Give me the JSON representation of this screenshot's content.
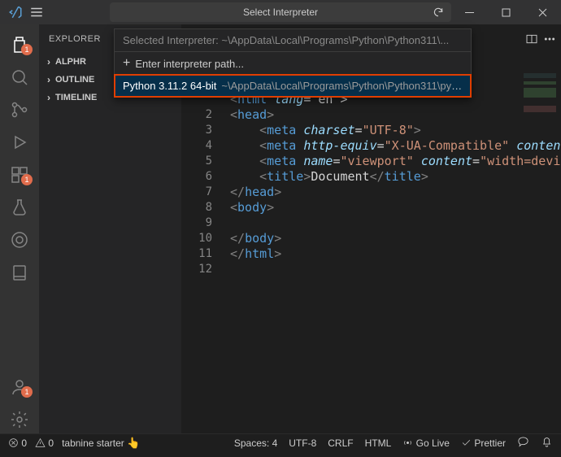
{
  "titlebar": {
    "command_center": "Select Interpreter"
  },
  "dropdown": {
    "header_prefix": "Selected Interpreter: ",
    "header_path": "~\\AppData\\Local\\Programs\\Python\\Python311\\...",
    "enter_path": "Enter interpreter path...",
    "selected_main": "Python 3.11.2 64-bit",
    "selected_path": "~\\AppData\\Local\\Programs\\Python\\Python311\\pyt..."
  },
  "explorer": {
    "title": "EXPLORER",
    "sections": [
      "ALPHR",
      "OUTLINE",
      "TIMELINE"
    ]
  },
  "activity_badges": {
    "explorer": "1",
    "extensions": "1",
    "accounts": "1"
  },
  "code": {
    "lines": [
      {
        "n": "",
        "html": "<span class='brk'>&lt;</span><span class='tag'>ntml</span><span class='txt-c'> </span><span class='attn'>lang</span><span class='txt-c'>= en &gt;</span>"
      },
      {
        "n": "2",
        "html": "<span class='brk'>&lt;</span><span class='tag'>head</span><span class='brk'>&gt;</span>"
      },
      {
        "n": "3",
        "html": "    <span class='brk'>&lt;</span><span class='tag'>meta</span> <span class='attn'>charset</span><span class='txt-c'>=</span><span class='str'>\"UTF-8\"</span><span class='brk'>&gt;</span>"
      },
      {
        "n": "4",
        "html": "    <span class='brk'>&lt;</span><span class='tag'>meta</span> <span class='attn'>http-equiv</span><span class='txt-c'>=</span><span class='str'>\"X-UA-Compatible\"</span> <span class='attn'>conten</span>"
      },
      {
        "n": "5",
        "html": "    <span class='brk'>&lt;</span><span class='tag'>meta</span> <span class='attn'>name</span><span class='txt-c'>=</span><span class='str'>\"viewport\"</span> <span class='attn'>content</span><span class='txt-c'>=</span><span class='str'>\"width=devi</span>"
      },
      {
        "n": "6",
        "html": "    <span class='brk'>&lt;</span><span class='tag'>title</span><span class='brk'>&gt;</span><span class='txt-c'>Document</span><span class='brk'>&lt;/</span><span class='tag'>title</span><span class='brk'>&gt;</span>"
      },
      {
        "n": "7",
        "html": "<span class='brk'>&lt;/</span><span class='tag'>head</span><span class='brk'>&gt;</span>"
      },
      {
        "n": "8",
        "html": "<span class='brk'>&lt;</span><span class='tag'>body</span><span class='brk'>&gt;</span>"
      },
      {
        "n": "9",
        "html": ""
      },
      {
        "n": "10",
        "html": "<span class='brk'>&lt;/</span><span class='tag'>body</span><span class='brk'>&gt;</span>"
      },
      {
        "n": "11",
        "html": "<span class='brk'>&lt;/</span><span class='tag'>html</span><span class='brk'>&gt;</span>"
      },
      {
        "n": "12",
        "html": ""
      }
    ]
  },
  "statusbar": {
    "errors": "0",
    "warnings": "0",
    "tabnine": "tabnine starter",
    "spaces": "Spaces: 4",
    "encoding": "UTF-8",
    "eol": "CRLF",
    "lang": "HTML",
    "golive": "Go Live",
    "prettier": "Prettier"
  }
}
